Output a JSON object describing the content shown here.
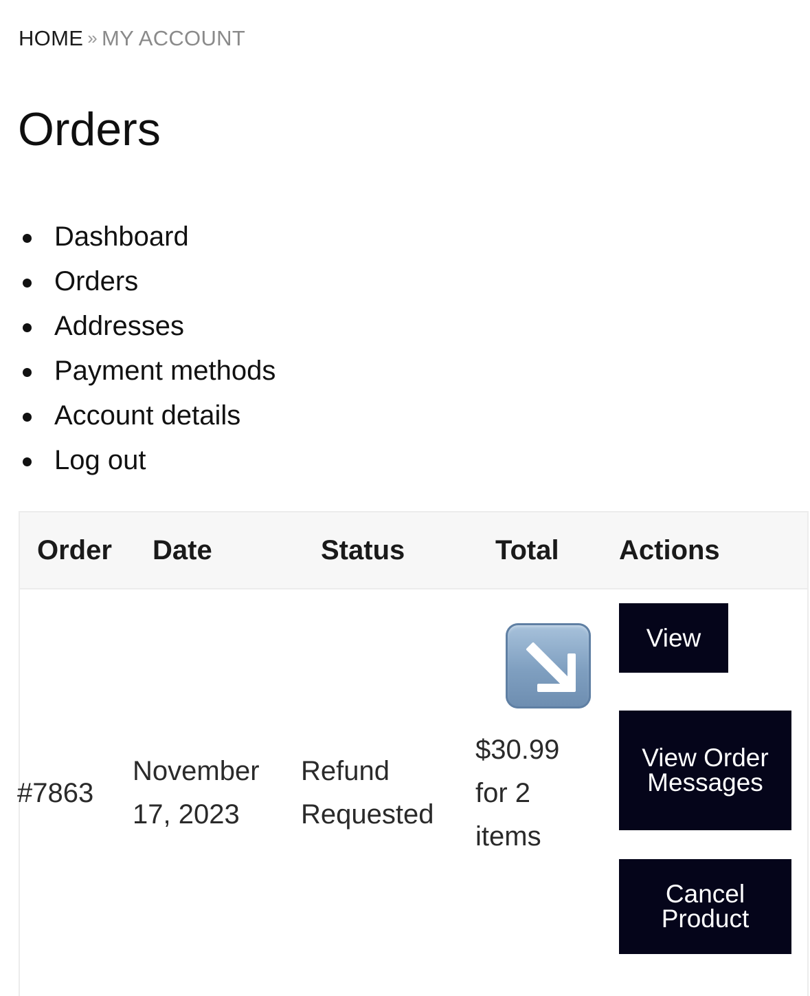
{
  "breadcrumb": {
    "home": "HOME",
    "separator": "»",
    "current": "MY ACCOUNT"
  },
  "page_title": "Orders",
  "account_nav": {
    "items": [
      {
        "label": "Dashboard"
      },
      {
        "label": "Orders"
      },
      {
        "label": "Addresses"
      },
      {
        "label": "Payment methods"
      },
      {
        "label": "Account details"
      },
      {
        "label": "Log out"
      }
    ]
  },
  "orders_table": {
    "headers": {
      "order": "Order",
      "date": "Date",
      "status": "Status",
      "total": "Total",
      "actions": "Actions"
    },
    "rows": [
      {
        "order": "#7863",
        "date": "November 17, 2023",
        "status": "Refund Requested",
        "total": "$30.99 for 2 items",
        "total_icon": "down-right-arrow-icon",
        "actions": {
          "view": "View",
          "view_messages": "View Order Messages",
          "cancel": "Cancel Product"
        }
      }
    ]
  },
  "colors": {
    "button_bg": "#05051a",
    "button_text": "#ffffff",
    "breadcrumb_current": "#8a8a8a",
    "table_header_bg": "#f7f7f7"
  }
}
